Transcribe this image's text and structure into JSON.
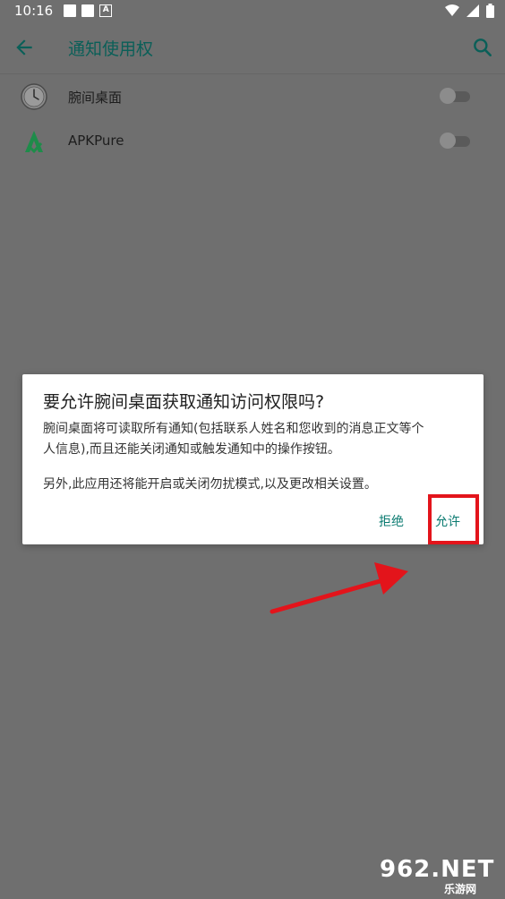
{
  "status_bar": {
    "time": "10:16"
  },
  "app_bar": {
    "title": "通知使用权"
  },
  "apps": [
    {
      "name": "腕间桌面",
      "icon": "watch-icon"
    },
    {
      "name": "APKPure",
      "icon": "apkpure-logo-icon"
    }
  ],
  "dialog": {
    "title": "要允许腕间桌面获取通知访问权限吗?",
    "body_line1": "腕间桌面将可读取所有通知(包括联系人姓名和您收到的消息正文等个",
    "body_line2": "人信息),而且还能关闭通知或触发通知中的操作按钮。",
    "body2": "另外,此应用还将能开启或关闭勿扰模式,以及更改相关设置。",
    "deny_label": "拒绝",
    "allow_label": "允许"
  },
  "watermark": {
    "main": "962.NET",
    "sub": "乐游网"
  },
  "colors": {
    "accent": "#0a7a70",
    "highlight": "#e3141b",
    "scrim": "#6f6f6f"
  }
}
